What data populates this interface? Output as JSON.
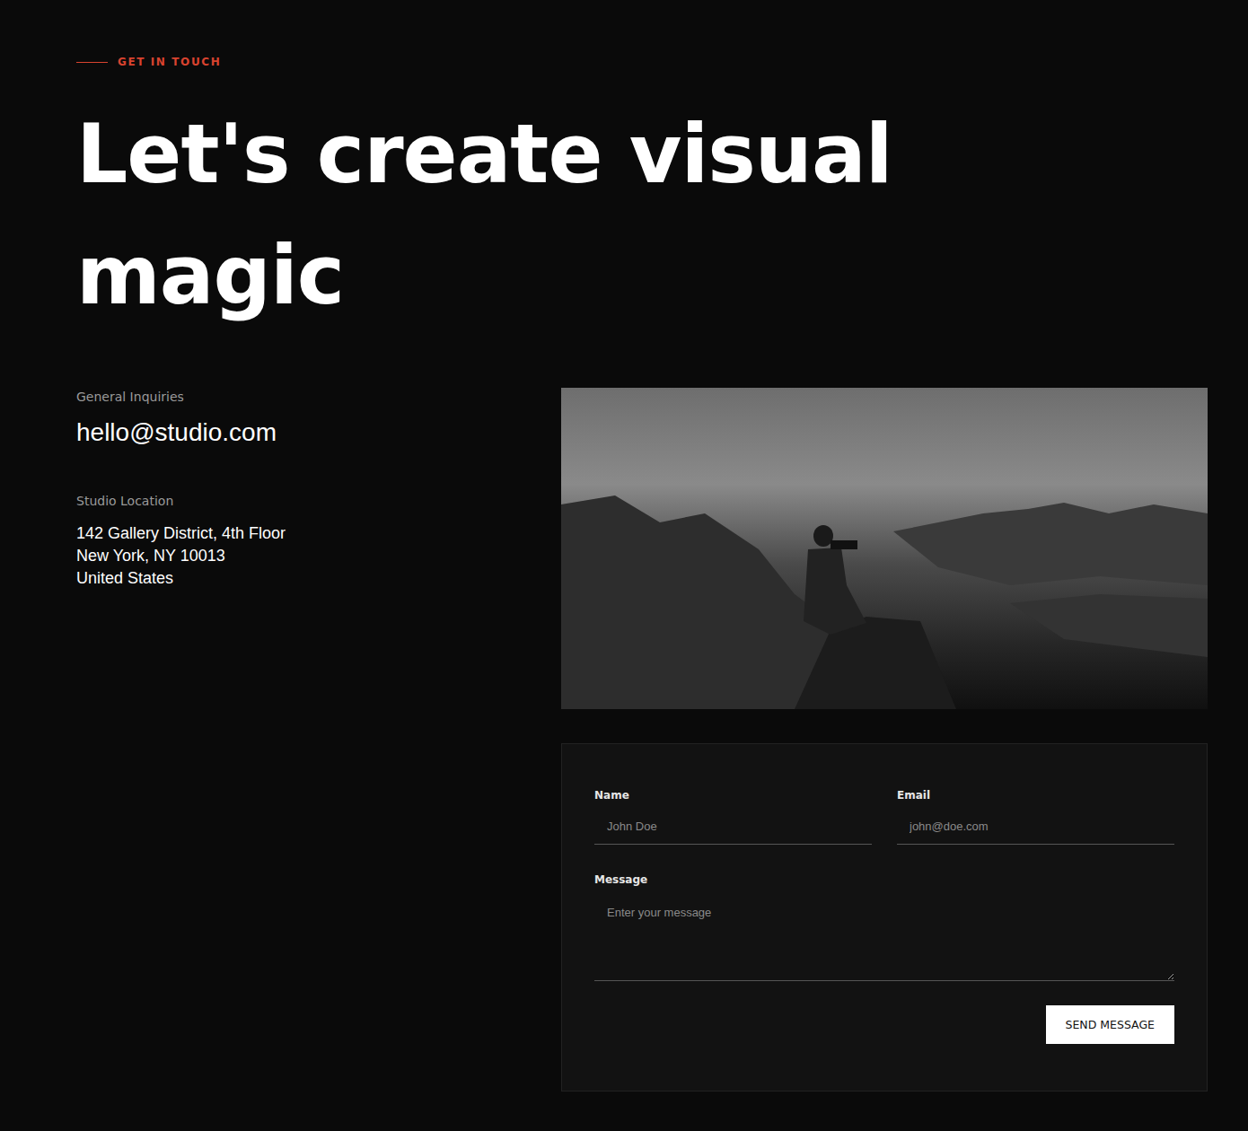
{
  "eyebrow": "GET IN TOUCH",
  "headline": "Let's create visual magic",
  "contacts": [
    {
      "label": "General Inquiries",
      "kind": "email",
      "lines": [
        "hello@studio.com"
      ]
    },
    {
      "label": "Studio Location",
      "kind": "address",
      "lines": [
        "142 Gallery District, 4th Floor",
        "New York, NY 10013",
        "United States"
      ]
    }
  ],
  "form": {
    "fields": [
      {
        "label": "Name",
        "placeholder": "John Doe",
        "kind": "text"
      },
      {
        "label": "Email",
        "placeholder": "john@doe.com",
        "kind": "text"
      },
      {
        "label": "Message",
        "placeholder": "Enter your message",
        "kind": "textarea"
      }
    ],
    "button": "SEND MESSAGE"
  }
}
